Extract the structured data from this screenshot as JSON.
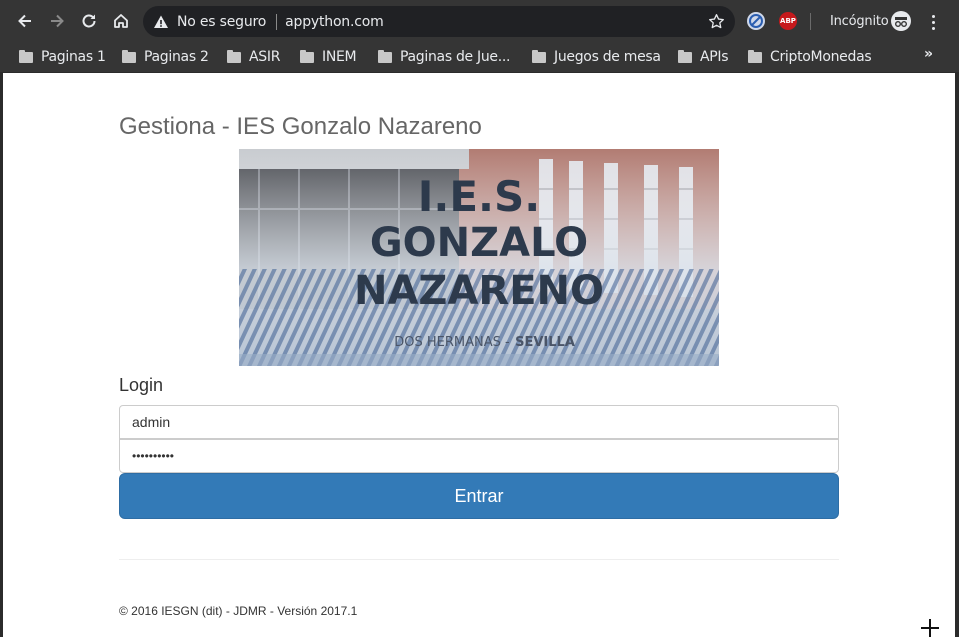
{
  "browser": {
    "security_label": "No es seguro",
    "url": "appython.com",
    "incognito_label": "Incógnito",
    "ext_abp_label": "ABP",
    "bookmarks": [
      {
        "label": "Paginas 1"
      },
      {
        "label": "Paginas 2"
      },
      {
        "label": "ASIR"
      },
      {
        "label": "INEM"
      },
      {
        "label": "Paginas de Jue..."
      },
      {
        "label": "Juegos de mesa"
      },
      {
        "label": "APIs"
      },
      {
        "label": "CriptoMonedas"
      }
    ],
    "bookmarks_overflow": "»"
  },
  "page": {
    "title": "Gestiona - IES Gonzalo Nazareno",
    "banner": {
      "line1": "I.E.S.",
      "line2": "GONZALO",
      "line3": "NAZARENO",
      "location_a": "DOS HERMANAS -",
      "location_b": "SEVILLA"
    },
    "login": {
      "heading": "Login",
      "username_value": "admin",
      "password_mask": "••••••••••",
      "submit_label": "Entrar"
    },
    "footer": "© 2016 IESGN (dit) - JDMR - Versión 2017.1"
  }
}
